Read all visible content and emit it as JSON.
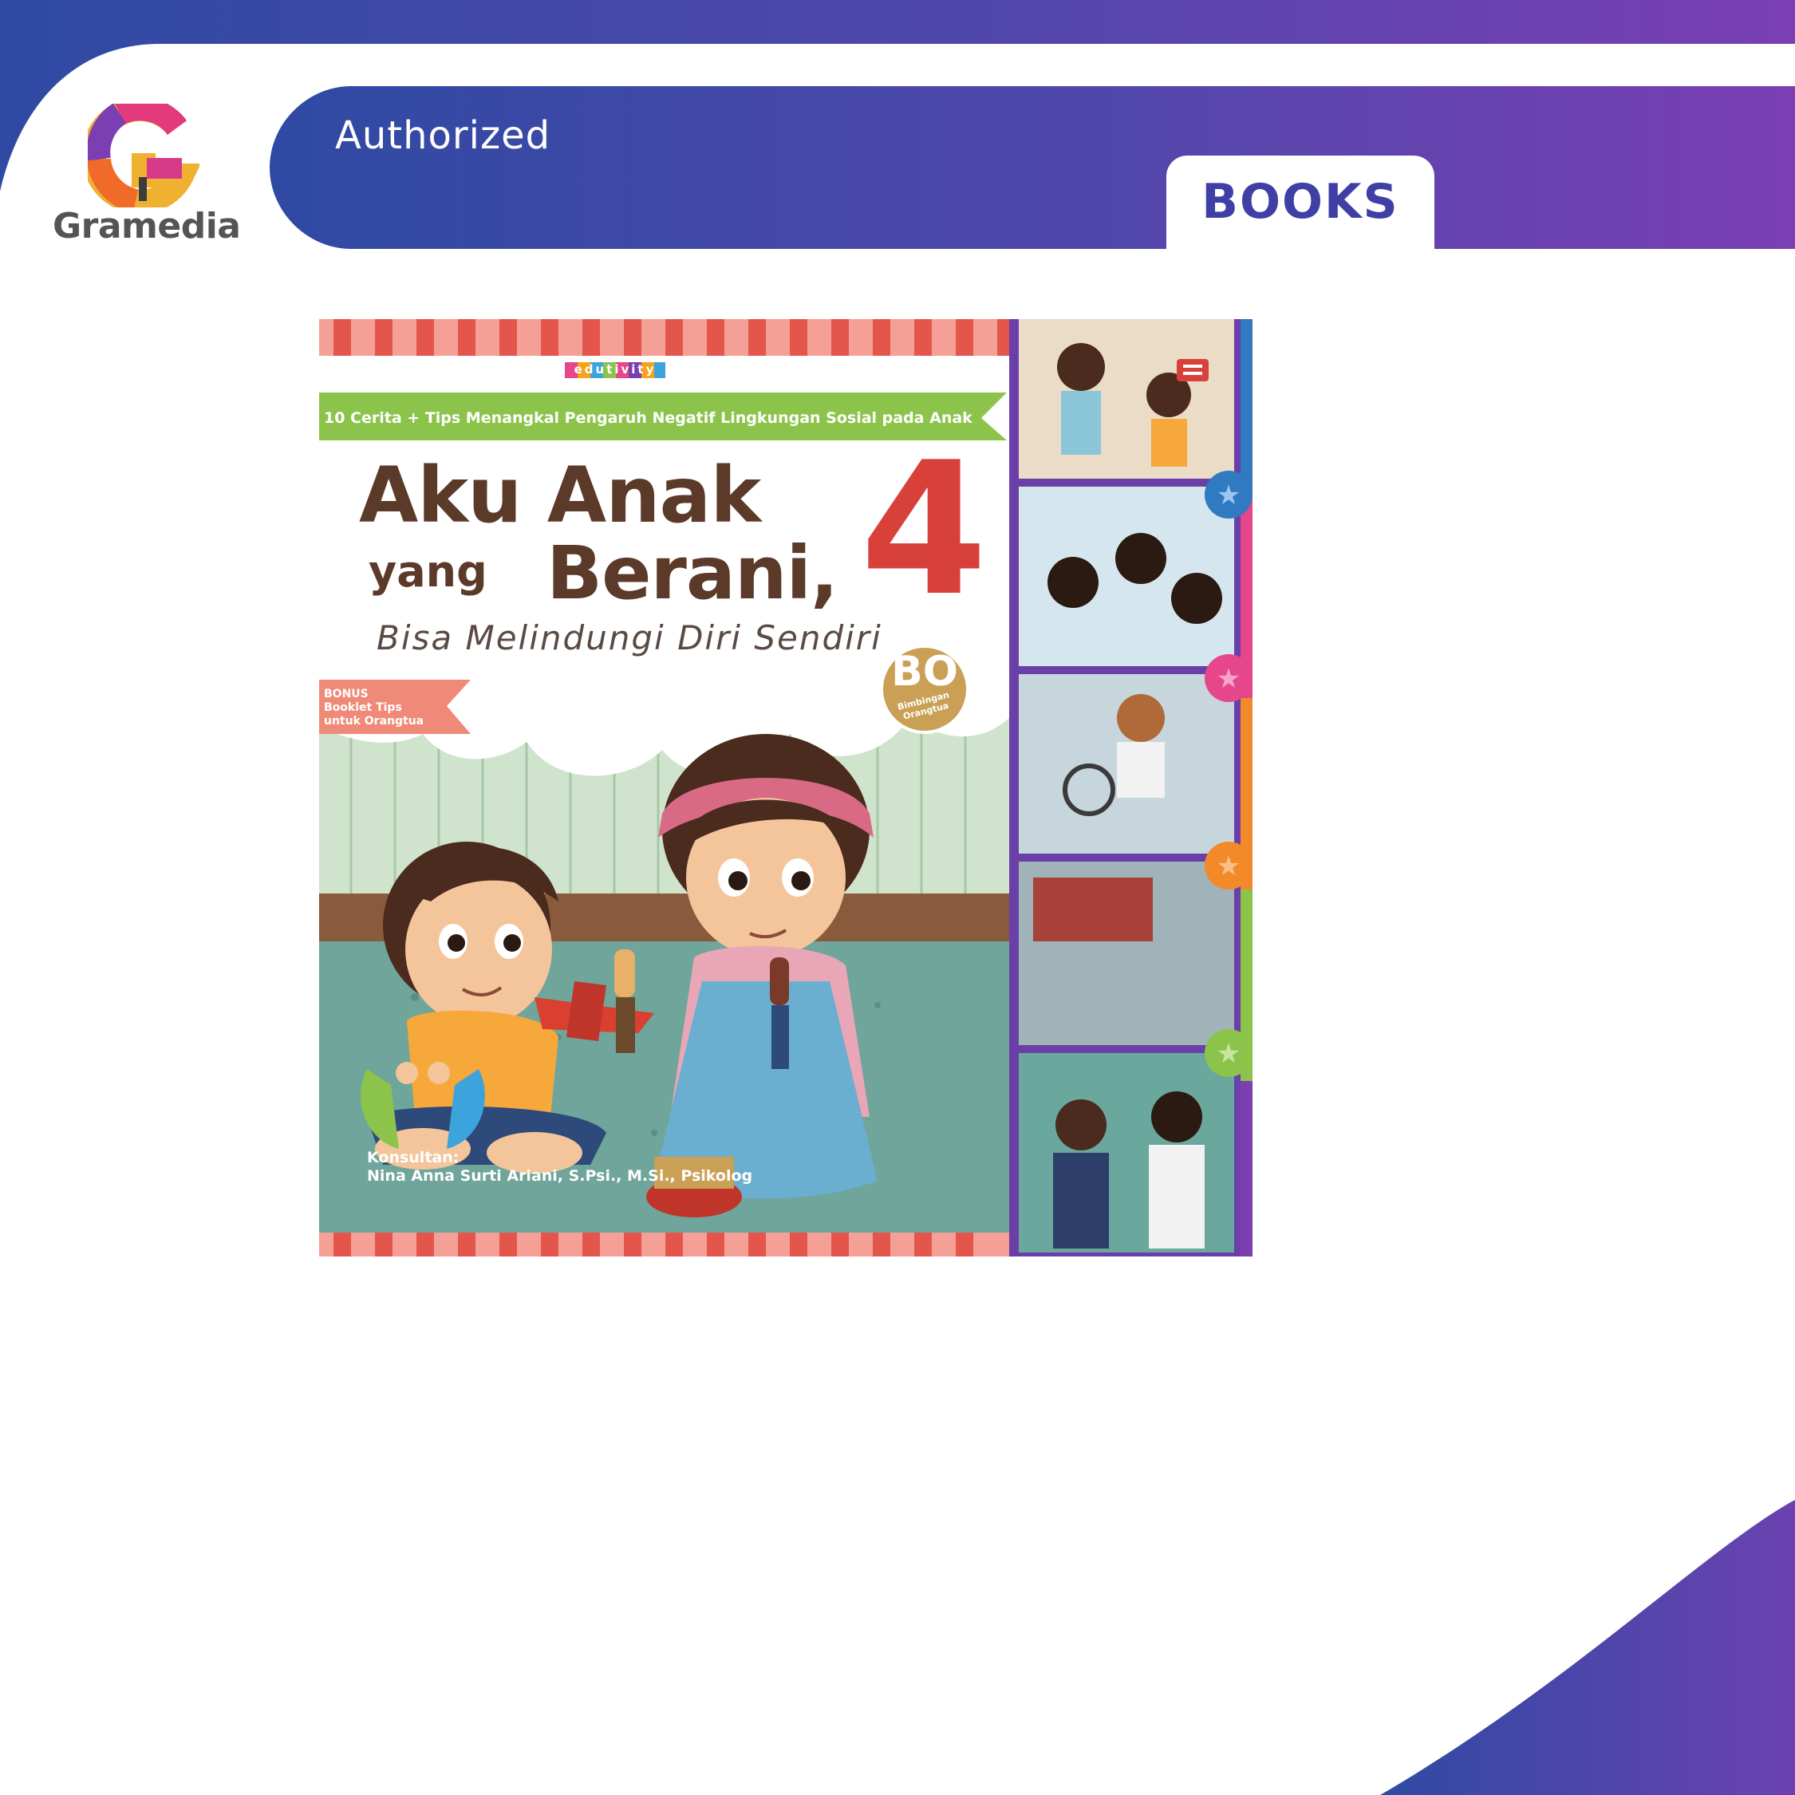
{
  "banner": {
    "label": "Authorized",
    "tab_label": "BOOKS",
    "colors": {
      "gradient_start": "#2f48a0",
      "gradient_end": "#7b3fb2",
      "tab_text": "#3f3fa6"
    }
  },
  "brand": {
    "name": "Gramedia",
    "logo_icon": "gramedia-g-logo-icon"
  },
  "book_cover": {
    "series": "edutivity",
    "subtitle": "10 Cerita + Tips Menangkal Pengaruh Negatif Lingkungan Sosial pada Anak",
    "title_line1": "Aku Anak",
    "title_line2_small": "yang",
    "title_line2_big": "Berani,",
    "volume": "4",
    "tagline": "Bisa Melindungi Diri Sendiri",
    "badge_big": "BO",
    "badge_small": "Bimbingan Orangtua",
    "bonus_title": "BONUS",
    "bonus_text": "Booklet Tips untuk Orangtua",
    "consultant_label": "Konsultan:",
    "consultant_name": "Nina Anna Surti Ariani, S.Psi., M.Si., Psikolog",
    "publisher_icon": "publisher-gm-logo-icon",
    "colors": {
      "title": "#5c3a2a",
      "volume": "#d8413a",
      "ribbon": "#8cc44b",
      "border_stripe": "#ee6a5c"
    }
  }
}
